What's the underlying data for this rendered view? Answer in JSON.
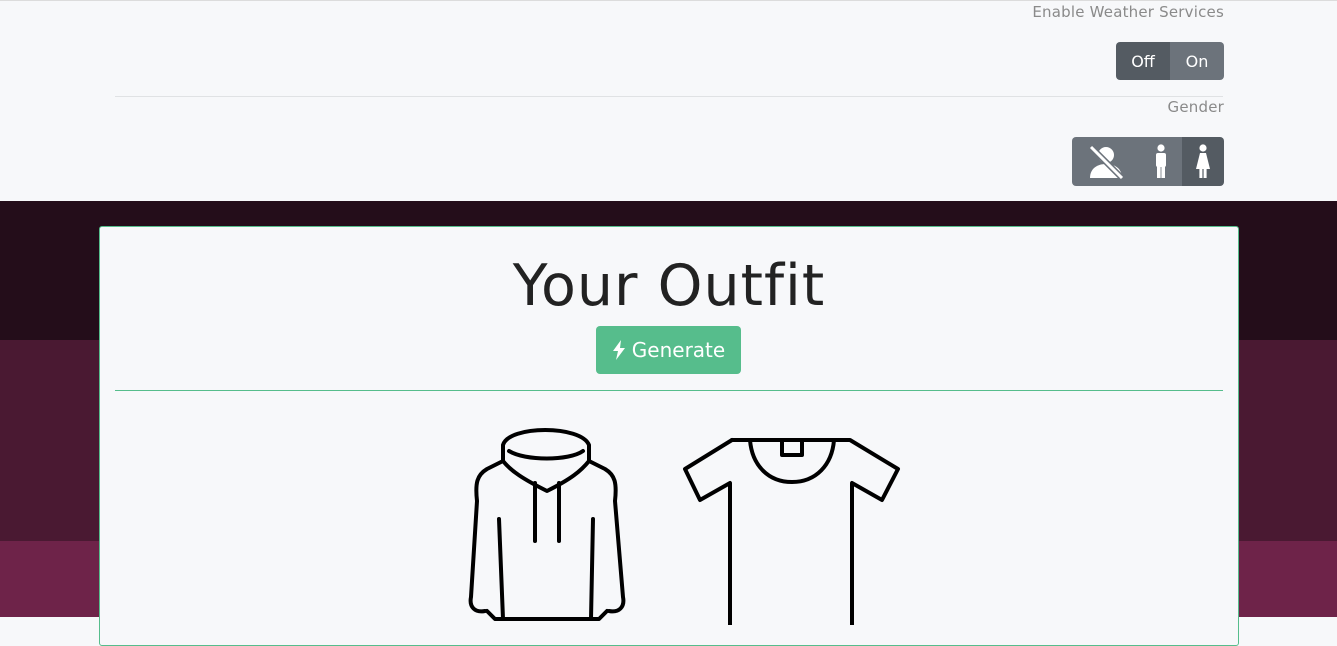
{
  "settings": {
    "weather_label": "Enable Weather Services",
    "weather_options": {
      "off": "Off",
      "on": "On"
    },
    "weather_selected": "Off",
    "gender_label": "Gender",
    "gender_options": [
      {
        "name": "none",
        "icon": "no-person-icon"
      },
      {
        "name": "male",
        "icon": "male-icon"
      },
      {
        "name": "female",
        "icon": "female-icon",
        "selected": true
      }
    ]
  },
  "outfit": {
    "title": "Your Outfit",
    "generate_label": "Generate",
    "items": [
      {
        "name": "hoodie",
        "icon": "hoodie-icon"
      },
      {
        "name": "t-shirt",
        "icon": "tshirt-icon"
      }
    ]
  },
  "colors": {
    "accent": "#56bd8c",
    "button_gray": "#6c737b",
    "button_active": "#545b62",
    "band_dark": "#240d1a",
    "band_mid": "#4a1932",
    "band_light": "#6e2349"
  }
}
